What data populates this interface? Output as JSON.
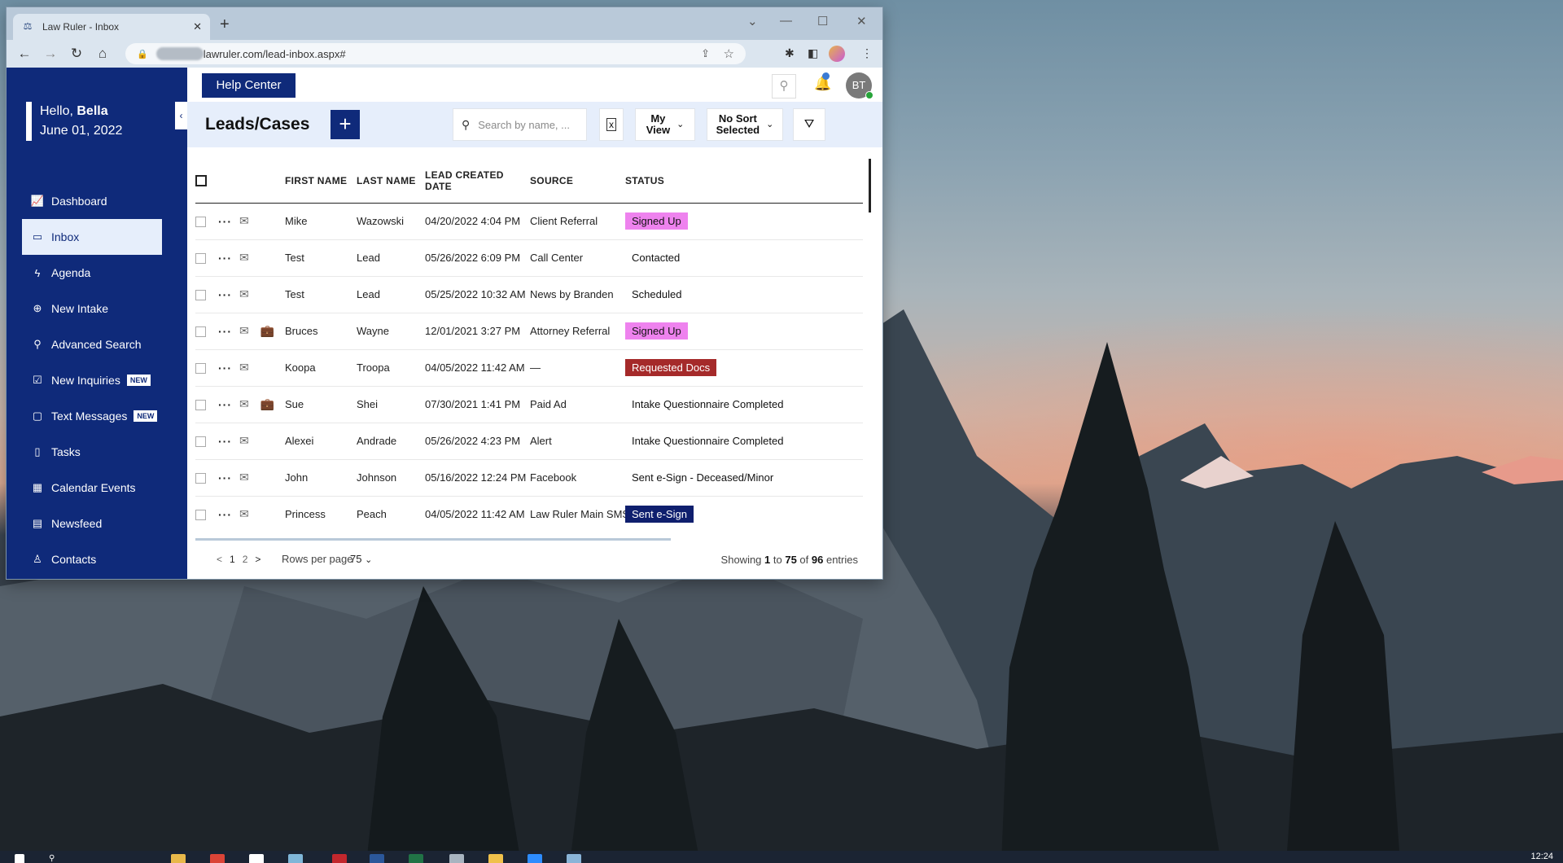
{
  "browser": {
    "tab_title": "Law Ruler - Inbox",
    "tab_icon": "scales-icon",
    "url": "lawruler.com/lead-inbox.aspx#"
  },
  "sidebar": {
    "greeting_prefix": "Hello, ",
    "user_name": "Bella",
    "date": "June 01, 2022",
    "items": [
      {
        "label": "Dashboard",
        "icon": "chart-icon",
        "glyph": "📈"
      },
      {
        "label": "Inbox",
        "icon": "inbox-icon",
        "glyph": "▭"
      },
      {
        "label": "Agenda",
        "icon": "bolt-icon",
        "glyph": "ϟ"
      },
      {
        "label": "New Intake",
        "icon": "plus-circle-icon",
        "glyph": "⊕"
      },
      {
        "label": "Advanced Search",
        "icon": "search-icon",
        "glyph": "⚲"
      },
      {
        "label": "New Inquiries",
        "icon": "checkbox-icon",
        "glyph": "☑",
        "badge": "NEW"
      },
      {
        "label": "Text Messages",
        "icon": "message-icon",
        "glyph": "▢",
        "badge": "NEW"
      },
      {
        "label": "Tasks",
        "icon": "clipboard-icon",
        "glyph": "▯"
      },
      {
        "label": "Calendar Events",
        "icon": "calendar-icon",
        "glyph": "▦"
      },
      {
        "label": "Newsfeed",
        "icon": "newspaper-icon",
        "glyph": "▤"
      },
      {
        "label": "Contacts",
        "icon": "person-icon",
        "glyph": "♙"
      }
    ]
  },
  "topbar": {
    "help_label": "Help Center",
    "avatar_initials": "BT"
  },
  "header": {
    "title": "Leads/Cases",
    "add_label": "+",
    "search_placeholder": "Search by name, ...",
    "view_label_1": "My",
    "view_label_2": "View",
    "sort_label_1": "No Sort",
    "sort_label_2": "Selected"
  },
  "table": {
    "columns": [
      "FIRST NAME",
      "LAST NAME",
      "LEAD CREATED DATE",
      "SOURCE",
      "STATUS"
    ],
    "rows": [
      {
        "first": "Mike",
        "last": "Wazowski",
        "date": "04/20/2022 4:04 PM",
        "source": "Client Referral",
        "status": "Signed Up",
        "status_bg": "#ee82ee",
        "status_fg": "#111111",
        "case_icon": false
      },
      {
        "first": "Test",
        "last": "Lead",
        "date": "05/26/2022 6:09 PM",
        "source": "Call Center",
        "status": "Contacted",
        "status_bg": "",
        "status_fg": "#111111",
        "case_icon": false
      },
      {
        "first": "Test",
        "last": "Lead",
        "date": "05/25/2022 10:32 AM",
        "source": "News by Branden",
        "status": "Scheduled",
        "status_bg": "",
        "status_fg": "#111111",
        "case_icon": false
      },
      {
        "first": "Bruces",
        "last": "Wayne",
        "date": "12/01/2021 3:27 PM",
        "source": "Attorney Referral",
        "status": "Signed Up",
        "status_bg": "#ee82ee",
        "status_fg": "#111111",
        "case_icon": true
      },
      {
        "first": "Koopa",
        "last": "Troopa",
        "date": "04/05/2022 11:42 AM",
        "source": "—",
        "status": "Requested Docs",
        "status_bg": "#a52a2a",
        "status_fg": "#ffffff",
        "case_icon": false
      },
      {
        "first": "Sue",
        "last": "Shei",
        "date": "07/30/2021 1:41 PM",
        "source": "Paid Ad",
        "status": "Intake Questionnaire Completed",
        "status_bg": "",
        "status_fg": "#111111",
        "case_icon": true
      },
      {
        "first": "Alexei",
        "last": "Andrade",
        "date": "05/26/2022 4:23 PM",
        "source": "Alert",
        "status": "Intake Questionnaire Completed",
        "status_bg": "",
        "status_fg": "#111111",
        "case_icon": false
      },
      {
        "first": "John",
        "last": "Johnson",
        "date": "05/16/2022 12:24 PM",
        "source": "Facebook",
        "status": "Sent e-Sign - Deceased/Minor",
        "status_bg": "",
        "status_fg": "#111111",
        "case_icon": false
      },
      {
        "first": "Princess",
        "last": "Peach",
        "date": "04/05/2022 11:42 AM",
        "source": "Law Ruler Main SMS",
        "status": "Sent e-Sign",
        "status_bg": "#0f1f6e",
        "status_fg": "#ffffff",
        "case_icon": false
      }
    ]
  },
  "footer": {
    "prev": "<",
    "page1": "1",
    "page2": "2",
    "next": ">",
    "rows_per_page_label": "Rows per page",
    "rows_per_page_value": "75",
    "showing_prefix": "Showing ",
    "showing_from": "1",
    "showing_to_word": " to ",
    "showing_to": "75",
    "showing_of_word": " of ",
    "showing_total": "96",
    "showing_suffix": " entries"
  },
  "taskbar": {
    "clock": "12:24"
  },
  "colors": {
    "brand_navy": "#0f2a7a",
    "header_bg": "#e6eefb"
  }
}
